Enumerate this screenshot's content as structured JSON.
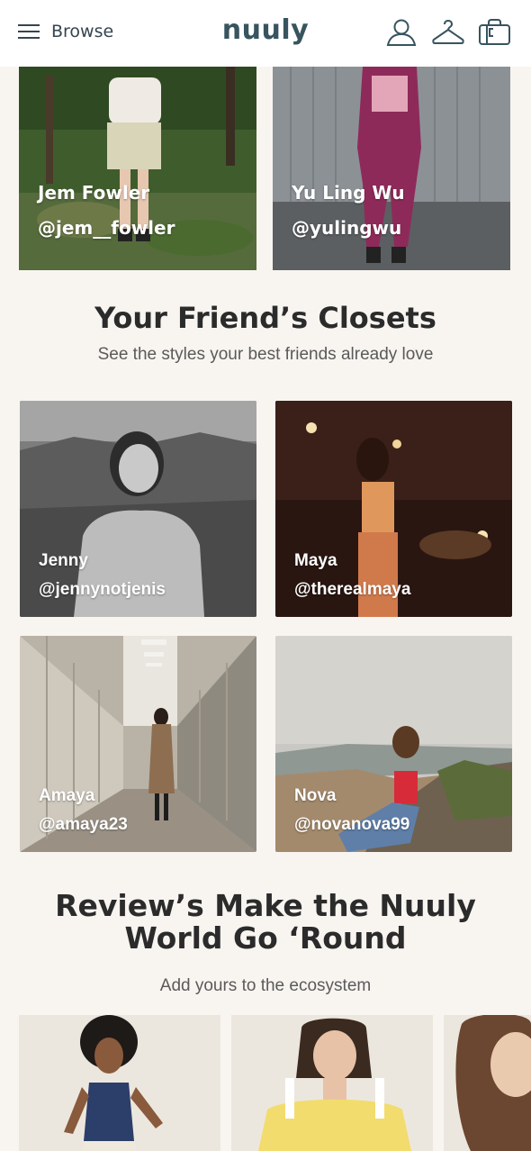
{
  "header": {
    "menu_label": "Browse",
    "logo_text": "nuuly",
    "icons": [
      "menu-icon",
      "user-icon",
      "hanger-icon",
      "bag-icon"
    ]
  },
  "influencers": [
    {
      "name": "Jem Fowler",
      "handle": "@jem__fowler"
    },
    {
      "name": "Yu Ling Wu",
      "handle": "@yulingwu"
    }
  ],
  "friends_section": {
    "title": "Your Friend’s Closets",
    "subtitle": "See the styles your best friends already love",
    "friends": [
      {
        "name": "Jenny",
        "handle": "@jennynotjenis"
      },
      {
        "name": "Maya",
        "handle": "@therealmaya"
      },
      {
        "name": "Amaya",
        "handle": "@amaya23"
      },
      {
        "name": "Nova",
        "handle": "@novanova99"
      }
    ]
  },
  "reviews_section": {
    "title_line1": "Review’s Make the Nuuly",
    "title_line2": "World Go ‘Round",
    "subtitle": "Add yours to the ecosystem"
  },
  "colors": {
    "background": "#f8f5f1",
    "header_bg": "#ffffff",
    "brand": "#37545f"
  }
}
